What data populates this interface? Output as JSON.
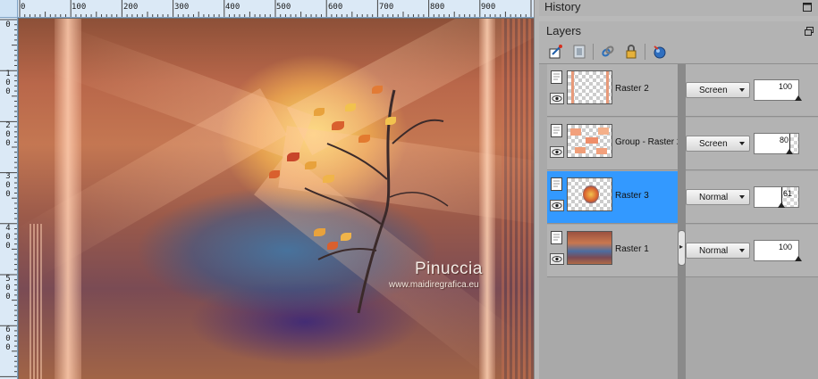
{
  "canvas": {
    "ruler_top_labels": [
      "0",
      "100",
      "200",
      "300",
      "400",
      "500",
      "600",
      "700",
      "800",
      "900"
    ],
    "ruler_left_labels": [
      [
        "0"
      ],
      [
        "1",
        "0",
        "0"
      ],
      [
        "2",
        "0",
        "0"
      ],
      [
        "3",
        "0",
        "0"
      ],
      [
        "4",
        "0",
        "0"
      ],
      [
        "5",
        "0",
        "0"
      ],
      [
        "6",
        "0",
        "0"
      ]
    ],
    "watermark": {
      "name": "Pinuccia",
      "url": "www.maidiregrafica.eu"
    }
  },
  "history": {
    "title": "History"
  },
  "layers": {
    "title": "Layers",
    "toolbar": [
      "new-raster-layer-icon",
      "new-mask-layer-icon",
      "link-icon",
      "lock-icon",
      "visibility-toggle-icon"
    ],
    "rows": [
      {
        "name": "Raster 2",
        "blend": "Screen",
        "opacity": 100,
        "selected": false
      },
      {
        "name": "Group - Raster 2",
        "blend": "Screen",
        "opacity": 80,
        "selected": false
      },
      {
        "name": "Raster 3",
        "blend": "Normal",
        "opacity": 61,
        "selected": true
      },
      {
        "name": "Raster 1",
        "blend": "Normal",
        "opacity": 100,
        "selected": false
      }
    ]
  },
  "colors": {
    "selection": "#3399ff",
    "panel": "#b3b3b3",
    "ruler": "#dbe9f6"
  }
}
